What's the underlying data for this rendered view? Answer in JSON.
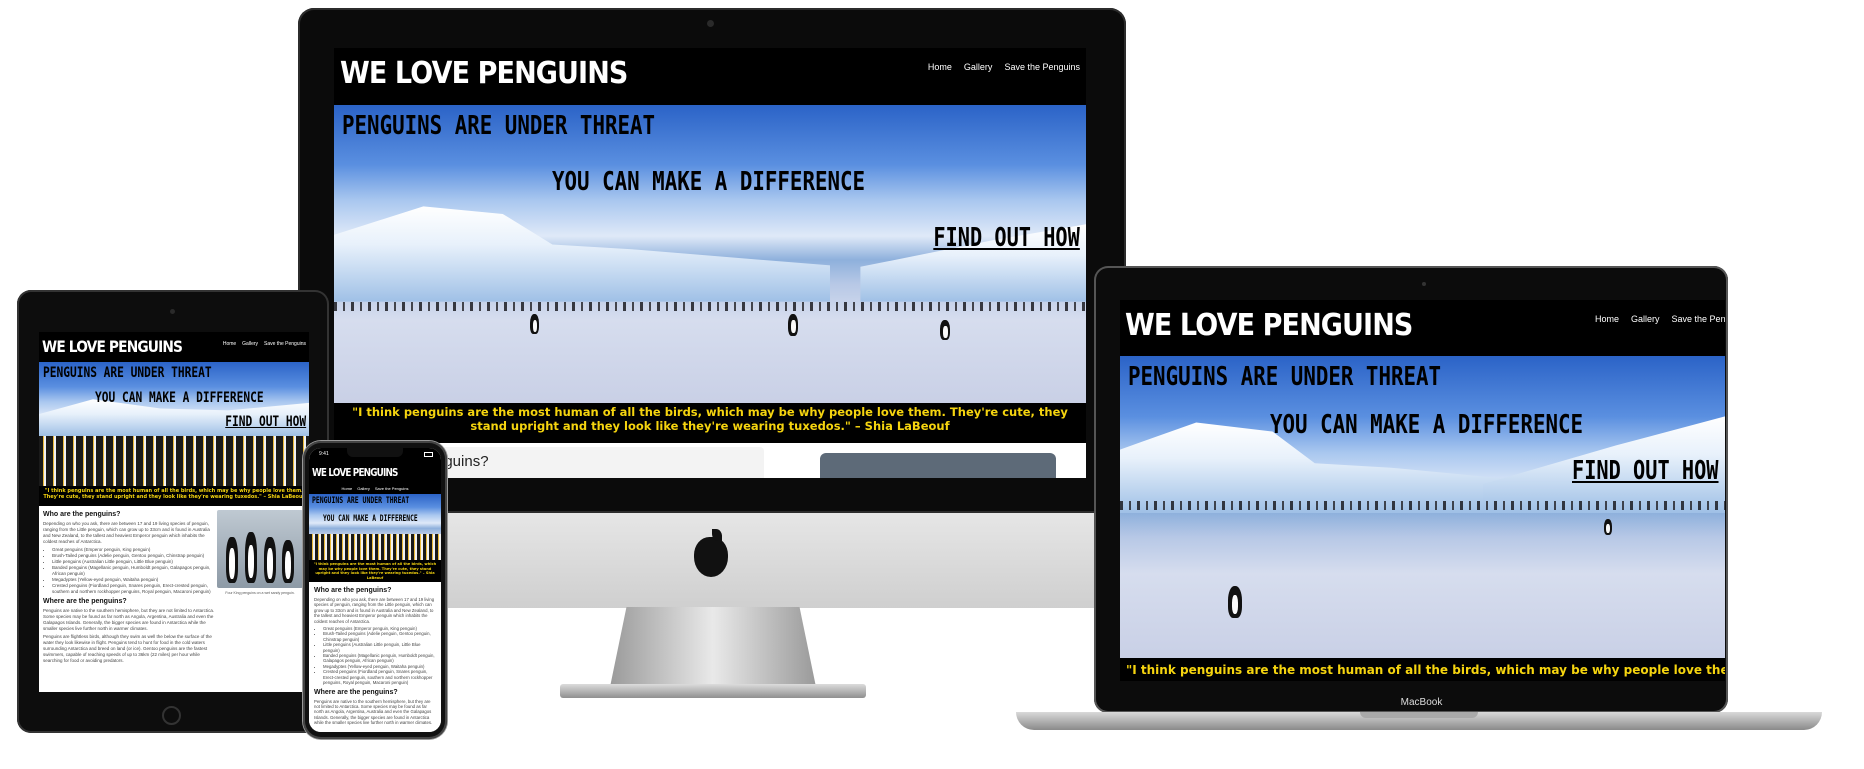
{
  "site": {
    "logo": "WE LOVE PENGUINS",
    "nav": [
      "Home",
      "Gallery",
      "Save the Penguins"
    ],
    "hero_line_1": "PENGUINS ARE UNDER THREAT",
    "hero_line_2": "YOU CAN MAKE A DIFFERENCE",
    "cta": "FIND OUT HOW",
    "quote": "\"I think penguins are the most human of all the birds, which may be why people love them. They're cute, they stand upright and they look like they're wearing tuxedos.\" – Shia LaBeouf",
    "section_who": "Who are the penguins?",
    "section_who_partial": "nguins?",
    "who_text": "Depending on who you ask, there are between 17 and 19 living species of penguin, ranging from the Little penguin, which can grow up to 33cm and is found in Australia and New Zealand, to the tallest and heaviest Emperor penguin which inhabits the coldest reaches of Antarctica.",
    "species": [
      "Great penguins (Emperor penguin, King penguin)",
      "Brush-Tailed penguins (Adelie penguin, Gentoo penguin, Chinstrap penguin)",
      "Little penguins (Australian Little penguin, Little Blue penguin)",
      "Banded penguins (Magellanic penguin, Humboldt penguin, Galapagos penguin, African penguin)",
      "Megadyptes (Yellow-eyed penguin, Waitaha penguin)",
      "Crested penguins (Fiordland penguin, Snares penguin, Erect-crested penguin, southern and northern rockhopper penguins, Royal penguin, Macaroni penguin)"
    ],
    "section_where": "Where are the penguins?",
    "where_text": "Penguins are native to the southern hemisphere, but they are not limited to Antarctica. Some species may be found as far north as Angola, Argentina, Australia and even the Galapagos Islands. Generally, the bigger species are found in Antarctica while the smaller species live further north in warmer climates.",
    "where_text_2": "Penguins are flightless birds, although they swim as well the below the surface of the water they look likewise in flight. Penguins tend to hunt for food in the cold waters surrounding Antarctica and breed on land (or ice). Gentoo penguins are the fastest swimmers, capable of reaching speeds of up to 36km (22 miles) per hour while searching for food or avoiding predators.",
    "photo_caption": "Four King penguins on a wet sandy penguin.",
    "status_time": "9:41"
  },
  "devices": {
    "laptop_label": "MacBook"
  },
  "colors": {
    "nav_bg": "#000000",
    "quote_text": "#f5d40f",
    "quote_bg": "#000000",
    "sky": "#5a8fe0",
    "device_frame": "#111111"
  }
}
